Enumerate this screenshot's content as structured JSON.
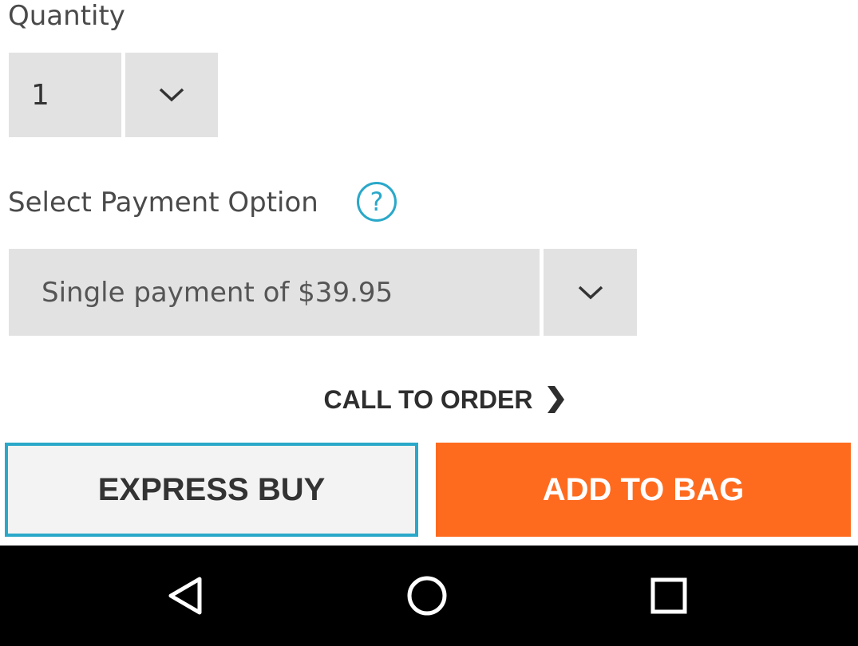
{
  "quantity": {
    "label": "Quantity",
    "value": "1",
    "toggle_icon": "chevron-down-icon"
  },
  "payment": {
    "label": "Select Payment Option",
    "help_icon": "question-icon",
    "help_glyph": "?",
    "selected": "Single payment of $39.95",
    "toggle_icon": "chevron-down-icon"
  },
  "call_to_order": {
    "label": "CALL TO ORDER",
    "icon": "chevron-right-icon"
  },
  "buttons": {
    "express_buy": "EXPRESS BUY",
    "add_to_bag": "ADD TO BAG"
  },
  "colors": {
    "accent_blue": "#2aa8c9",
    "add_to_bag_orange": "#fe6b1f",
    "select_gray": "#e2e2e2",
    "nav_bar": "#000000"
  },
  "nav_bar": {
    "back_icon": "back-triangle-icon",
    "home_icon": "home-circle-icon",
    "recents_icon": "recents-square-icon"
  }
}
